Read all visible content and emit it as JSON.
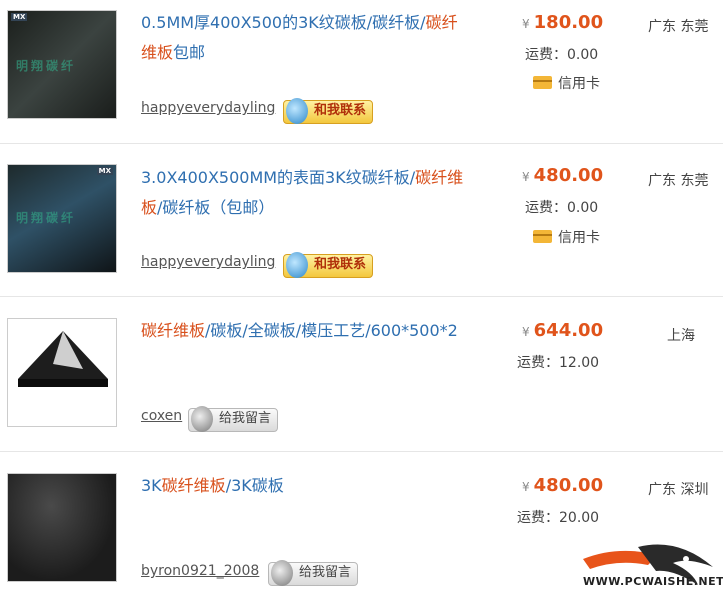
{
  "items": [
    {
      "title_parts": [
        "0.5MM厚400X500的3K纹碳板/碳纤板/",
        "碳纤维板",
        "包邮"
      ],
      "seller": "happyeverydayling",
      "contact": "和我联系",
      "price": "180.00",
      "currency": "¥",
      "fee": "运费：0.00",
      "payment": "信用卡",
      "location": "广东 东莞",
      "thumb_watermark": "明翔碳纤",
      "thumb_tag": "MX"
    },
    {
      "title_parts": [
        "3.0X400X500MM的表面3K纹碳纤板/",
        "碳纤维板",
        "/碳纤板（包邮）"
      ],
      "seller": "happyeverydayling",
      "contact": "和我联系",
      "price": "480.00",
      "currency": "¥",
      "fee": "运费：0.00",
      "payment": "信用卡",
      "location": "广东 东莞",
      "thumb_watermark": "明翔碳纤",
      "thumb_tag": "MX"
    },
    {
      "title_parts": [
        "",
        "碳纤维板",
        "/碳板/全碳板/模压工艺/600*500*2"
      ],
      "seller": "coxen",
      "contact": "给我留言",
      "price": "644.00",
      "currency": "¥",
      "fee": "运费：12.00",
      "location": "上海"
    },
    {
      "title_parts": [
        "3K",
        "碳纤维板",
        "/3K碳板"
      ],
      "seller": "byron0921_2008",
      "contact": "给我留言",
      "price": "480.00",
      "currency": "¥",
      "fee": "运费：20.00",
      "location": "广东 深圳"
    }
  ],
  "watermark_site": "WWW.PCWAISHE.NET",
  "colors": {
    "link_blue": "#2f6fb0",
    "highlight_orange": "#d8501c",
    "price_orange": "#e0541b"
  }
}
